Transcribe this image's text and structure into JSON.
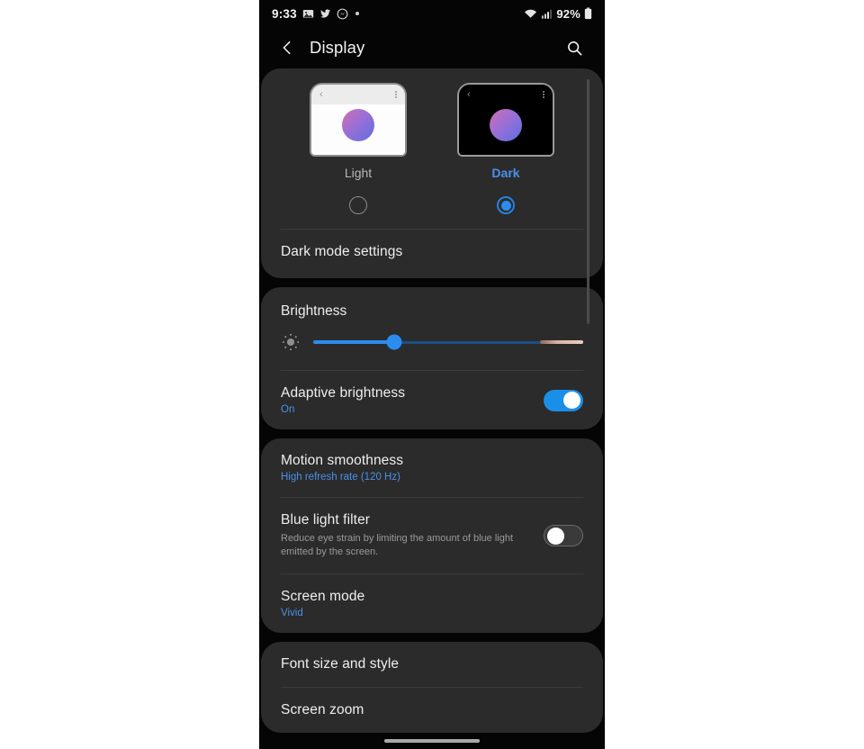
{
  "status_bar": {
    "time": "9:33",
    "left_icons": [
      "photo-icon",
      "twitter-icon",
      "messenger-icon",
      "dot-icon"
    ],
    "wifi_icon": "wifi-icon",
    "signal_icon": "signal-icon",
    "battery_percent": "92%",
    "battery_icon": "battery-icon"
  },
  "app_bar": {
    "back_icon": "back-chevron-icon",
    "title": "Display",
    "search_icon": "search-icon"
  },
  "theme": {
    "light": {
      "label": "Light",
      "selected": false
    },
    "dark": {
      "label": "Dark",
      "selected": true
    },
    "dark_mode_settings": "Dark mode settings"
  },
  "brightness": {
    "title": "Brightness",
    "icon": "brightness-sun-icon",
    "value_percent": 30,
    "adaptive": {
      "title": "Adaptive brightness",
      "status": "On",
      "toggle_on": true
    }
  },
  "display_options": [
    {
      "title": "Motion smoothness",
      "sub": "High refresh rate (120 Hz)"
    },
    {
      "title": "Blue light filter",
      "desc": "Reduce eye strain by limiting the amount of blue light emitted by the screen.",
      "toggle_on": false
    },
    {
      "title": "Screen mode",
      "sub": "Vivid"
    }
  ],
  "text_options": [
    {
      "title": "Font size and style"
    },
    {
      "title": "Screen zoom"
    }
  ],
  "colors": {
    "accent_blue": "#4a90e8",
    "toggle_on": "#1a8fe8",
    "card_bg": "#2b2b2b",
    "page_bg": "#050505"
  }
}
